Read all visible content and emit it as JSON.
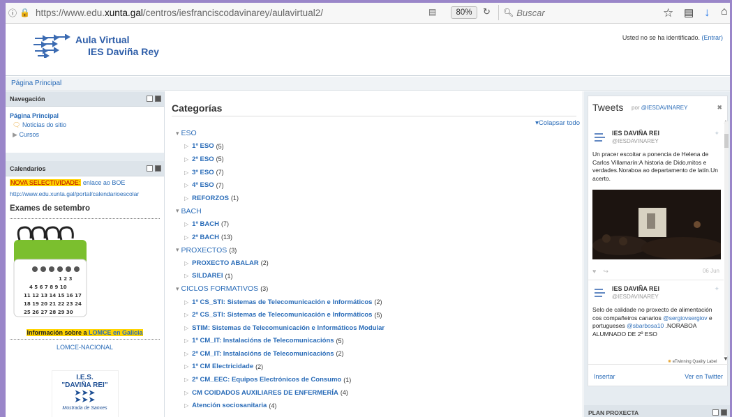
{
  "browser": {
    "url_prefix": "https://www.edu.",
    "url_domain": "xunta.gal",
    "url_path": "/centros/iesfranciscodavinarey/aulavirtual2/",
    "zoom": "80%",
    "search_placeholder": "Buscar"
  },
  "header": {
    "title_line1": "Aula Virtual",
    "title_line2": "IES Daviña Rey",
    "login_text": "Usted no se ha identificado.",
    "login_link": "(Entrar)"
  },
  "breadcrumb": "Página Principal",
  "navigation": {
    "title": "Navegación",
    "home": "Página Principal",
    "items": [
      "Noticias do sitio",
      "Cursos"
    ]
  },
  "calendarios": {
    "title": "Calendarios",
    "highlight": "NOVA SELECTIVIDADE:",
    "highlight_rest": " enlace ao BOE",
    "link": "http://www.edu.xunta.gal/portal/calendarioescolar",
    "exames": "Exames de setembro",
    "lomce_pre": "Información sobre a ",
    "lomce_hl": "LOMCE en Galicia",
    "lomce_nacional": "LOMCE-NACIONAL",
    "ies_logo_l1": "I.E.S.",
    "ies_logo_l2": "\"DAVIÑA REI\"",
    "ies_logo_l3": "Mostrada de Sanxes"
  },
  "categories": {
    "title": "Categorías",
    "collapse_all": "Colapsar todo",
    "rows": [
      {
        "level": 0,
        "label": "ESO",
        "count": ""
      },
      {
        "level": 1,
        "label": "1º ESO",
        "count": "(5)"
      },
      {
        "level": 1,
        "label": "2º ESO",
        "count": "(5)"
      },
      {
        "level": 1,
        "label": "3º ESO",
        "count": "(7)"
      },
      {
        "level": 1,
        "label": "4º ESO",
        "count": "(7)"
      },
      {
        "level": 1,
        "label": "REFORZOS",
        "count": "(1)"
      },
      {
        "level": 0,
        "label": "BACH",
        "count": ""
      },
      {
        "level": 1,
        "label": "1º BACH",
        "count": "(7)"
      },
      {
        "level": 1,
        "label": "2º BACH",
        "count": "(13)"
      },
      {
        "level": 0,
        "label": "PROXECTOS",
        "count": "(3)"
      },
      {
        "level": 1,
        "label": "PROXECTO ABALAR",
        "count": "(2)"
      },
      {
        "level": 1,
        "label": "SILDAREI",
        "count": "(1)"
      },
      {
        "level": 0,
        "label": "CICLOS FORMATIVOS",
        "count": "(3)"
      },
      {
        "level": 1,
        "label": "1º CS_STI: Sistemas de Telecomunicación e Informáticos",
        "count": "(2)"
      },
      {
        "level": 1,
        "label": "2º CS_STI: Sistemas de Telecomunicación e Informáticos",
        "count": "(5)"
      },
      {
        "level": 1,
        "label": "STIM: Sistemas de Telecomunicación e Informáticos Modular",
        "count": ""
      },
      {
        "level": 1,
        "label": "1º CM_IT: Instalacións de Telecomunicacións",
        "count": "(5)"
      },
      {
        "level": 1,
        "label": "2º CM_IT: Instalacións de Telecomunicacións",
        "count": "(2)"
      },
      {
        "level": 1,
        "label": "1º CM Electricidade",
        "count": "(2)"
      },
      {
        "level": 1,
        "label": "2º CM_EEC: Equipos Electrónicos de Consumo",
        "count": "(1)"
      },
      {
        "level": 1,
        "label": "CM COIDADOS AUXILIARES DE ENFERMERÍA",
        "count": "(4)"
      },
      {
        "level": 1,
        "label": "Atención sociosanitaria",
        "count": "(4)"
      }
    ]
  },
  "tweets": {
    "title": "Tweets",
    "by": "por",
    "by_handle": "@IESDAVINAREY",
    "items": [
      {
        "name": "IES DAVIÑA REI",
        "handle": "@IESDAVINAREY",
        "text": "Un pracer escoitar a ponencia de Helena de Carlos Villamarín:A historia de Dido,mitos e verdades.Noraboa ao departamento de latín.Un acerto.",
        "date": "06 Jun"
      },
      {
        "name": "IES DAVIÑA REI",
        "handle": "@IESDAVINAREY",
        "text_pre": "Selo de calidade no proxecto de alimentación cos compañeiros canarios ",
        "mention1": "@sergiovsergiov",
        "text_mid": " e portugueses ",
        "mention2": "@sbarbosa10",
        "text_post": " .NORABOA ALUMNADO DE 2º ESO",
        "badge": "eTwinning Quality Label"
      }
    ],
    "insert": "Insertar",
    "view": "Ver en Twitter"
  },
  "plan_proxecta": "PLAN PROXECTA"
}
